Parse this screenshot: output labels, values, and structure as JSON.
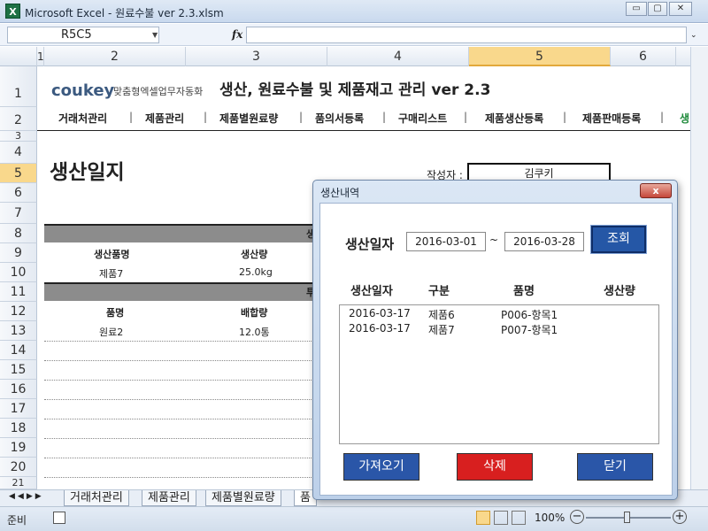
{
  "window": {
    "title": "Microsoft Excel - 원료수불 ver 2.3.xlsm",
    "app_icon": "X",
    "min": "▭",
    "max": "▢",
    "close": "✕"
  },
  "formula_bar": {
    "name_box": "R5C5",
    "fx": "fx",
    "formula": ""
  },
  "columns": [
    "1",
    "2",
    "3",
    "4",
    "5",
    "6"
  ],
  "rows": [
    "1",
    "2",
    "3",
    "4",
    "5",
    "6",
    "7",
    "8",
    "9",
    "10",
    "11",
    "12",
    "13",
    "14",
    "15",
    "16",
    "17",
    "18",
    "19",
    "20",
    "21"
  ],
  "header": {
    "brand": "coukey",
    "brand_sub": "맞춤형엑셀업무자동화",
    "title": "생산, 원료수불 및 제품재고 관리 ver 2.3"
  },
  "nav": [
    "거래처관리",
    "제품관리",
    "제품별원료량",
    "품의서등록",
    "구매리스트",
    "제품생산등록",
    "제품판매등록",
    "생"
  ],
  "page": {
    "title": "생산일지",
    "author_label": "작성자 :",
    "author": "김쿠키",
    "produced_label": "생산일자"
  },
  "table": {
    "section1_header": "생",
    "col1": "생산품명",
    "col2": "생산량",
    "row1": {
      "name": "제품7",
      "qty": "25.0kg"
    },
    "section2_header": "투",
    "col3": "품명",
    "col4": "배합량",
    "row2": {
      "name": "원료2",
      "qty": "12.0통"
    }
  },
  "sheet_tabs": [
    "거래처관리",
    "제품관리",
    "제품별원료량",
    "품"
  ],
  "status": {
    "ready": "준비",
    "zoom": "100%",
    "minus": "−",
    "plus": "+"
  },
  "dialog": {
    "title": "생산내역",
    "close": "x",
    "date_label": "생산일자",
    "date_from": "2016-03-01",
    "tilde": "~",
    "date_to": "2016-03-28",
    "search": "조회",
    "list_headers": [
      "생산일자",
      "구분",
      "품명",
      "생산량"
    ],
    "rows": [
      {
        "date": "2016-03-17",
        "type": "제품6",
        "item": "P006-항목1"
      },
      {
        "date": "2016-03-17",
        "type": "제품7",
        "item": "P007-항목1"
      }
    ],
    "buttons": {
      "import": "가져오기",
      "delete": "삭제",
      "close": "닫기"
    },
    "colors": {
      "import": "#2a56a8",
      "delete": "#d81f1f",
      "close": "#2a56a8"
    }
  }
}
